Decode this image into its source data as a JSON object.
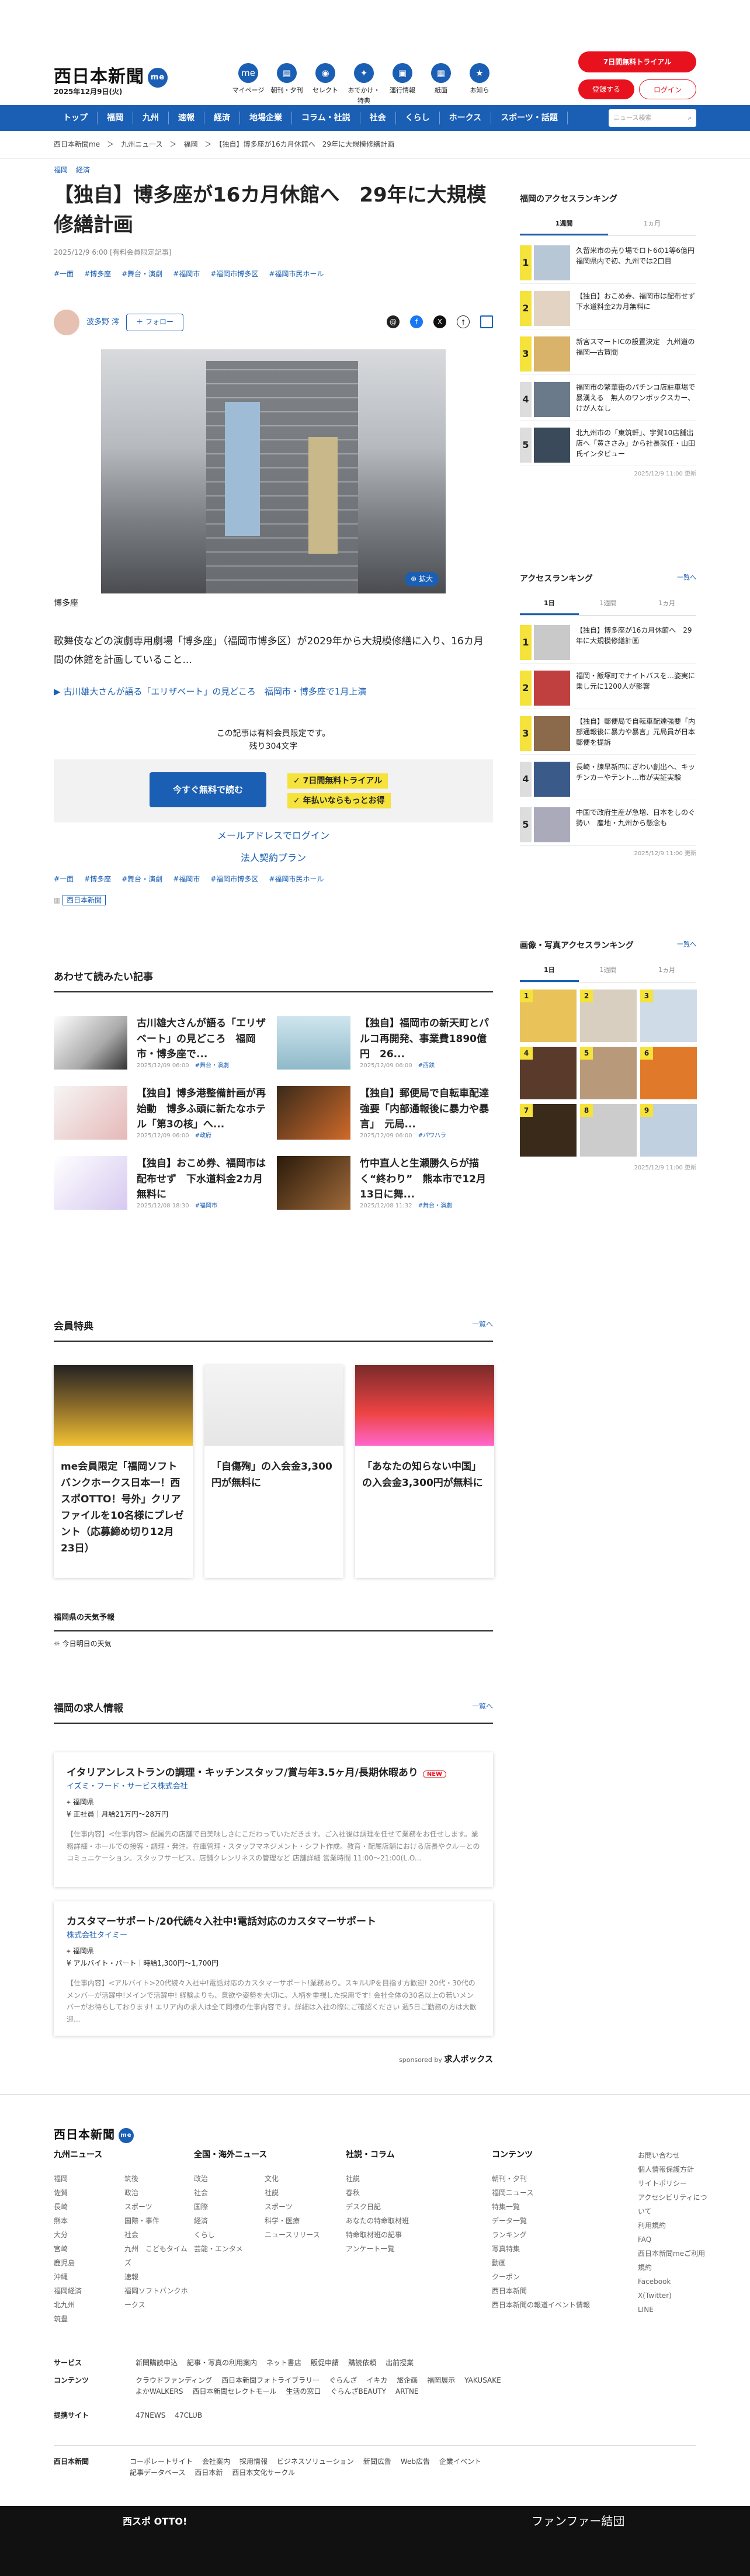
{
  "header": {
    "logo": "西日本新聞",
    "me": "me",
    "date": "2025年12月9日(火)",
    "nav": [
      {
        "label": "マイページ",
        "icon": "person-icon"
      },
      {
        "label": "朝刊・夕刊",
        "icon": "paper-icon"
      },
      {
        "label": "セレクト",
        "icon": "select-icon"
      },
      {
        "label": "おでかけ・特典",
        "icon": "ticket-icon"
      },
      {
        "label": "運行情報",
        "icon": "train-icon"
      },
      {
        "label": "紙面",
        "icon": "newspaper-icon"
      },
      {
        "label": "お知ら",
        "icon": "police-icon"
      }
    ],
    "trial": "7日間無料トライアル",
    "register": "登録する",
    "login": "ログイン"
  },
  "gnav": {
    "items": [
      "トップ",
      "福岡",
      "九州",
      "速報",
      "経済",
      "地場企業",
      "コラム・社説",
      "社会",
      "くらし",
      "ホークス",
      "スポーツ・話題"
    ],
    "search": "ニュース検索"
  },
  "breadcrumb": "西日本新聞me　＞　九州ニュース　＞　福岡　＞　【独自】博多座が16カ月休館へ　29年に大規模修繕計画",
  "article": {
    "categories": [
      "福岡",
      "経済"
    ],
    "title": "【独自】博多座が16カ月休館へ　29年に大規模修繕計画",
    "meta": "2025/12/9 6:00 [有料会員限定記事]",
    "tags": [
      "#一面",
      "#博多座",
      "#舞台・演劇",
      "#福岡市",
      "#福岡市博多区",
      "#福岡市民ホール"
    ],
    "author": "波多野 澪",
    "follow": "＋ フォロー",
    "zoom": "拡大",
    "caption": "博多座",
    "lede": "歌舞伎などの演劇専用劇場「博多座」（福岡市博多区）が2029年から大規模修繕に入り、16カ月間の休館を計画していること...",
    "related": "古川雄大さんが語る「エリザベート」の見どころ　福岡市・博多座で1月上演",
    "paywall_note": "この記事は有料会員限定です。",
    "remaining": "残り304文字",
    "cta": "今すぐ無料で読む",
    "check1": "7日間無料トライアル",
    "check2": "年払いならもっとお得",
    "mail_login": "メールアドレスでログイン",
    "corp": "法人契約プラン",
    "badge": "西日本新聞"
  },
  "recommend": {
    "title": "あわせて読みたい記事",
    "items": [
      {
        "title": "古川雄大さんが語る「エリザベート」の見どころ　福岡市・博多座で...",
        "date": "2025/12/09 06:00",
        "cat": "#舞台・演劇"
      },
      {
        "title": "【独自】福岡市の新天町とパルコ再開発、事業費1890億円　26...",
        "date": "2025/12/09 06:00",
        "cat": "#西鉄"
      },
      {
        "title": "【独自】博多港整備計画が再始動　博多ふ頭に新たなホテル「第3の核」へ...",
        "date": "2025/12/09 06:00",
        "cat": "#政府"
      },
      {
        "title": "【独自】郵便局で自転車配達強要「内部通報後に暴力や暴言」　元局...",
        "date": "2025/12/09 06:00",
        "cat": "#パワハラ"
      },
      {
        "title": "【独自】おこめ券、福岡市は配布せず　下水道料金2カ月無料に",
        "date": "2025/12/08 18:30",
        "cat": "#福岡市"
      },
      {
        "title": "竹中直人と生瀬勝久らが描く“終わり”　熊本市で12月13日に舞...",
        "date": "2025/12/08 11:32",
        "cat": "#舞台・演劇"
      }
    ]
  },
  "perks": {
    "title": "会員特典",
    "more": "一覧へ",
    "items": [
      "me会員限定「福岡ソフトバンクホークス日本一！西スポOTTO！号外」クリアファイルを10名様にプレゼント（応募締め切り12月23日）",
      "「自傷殉」の入会金3,300円が無料に",
      "「あなたの知らない中国」の入会金3,300円が無料に"
    ]
  },
  "weather": {
    "title": "福岡県の天気予報",
    "today": "今日明日の天気"
  },
  "jobs": {
    "title": "福岡の求人情報",
    "more": "一覧へ",
    "items": [
      {
        "title": "イタリアンレストランの調理・キッチンスタッフ/賞与年3.5ヶ月/長期休暇あり",
        "new": "NEW",
        "company": "イズミ・フード・サービス株式会社",
        "place": "福岡県",
        "pay": "正社員｜月給21万円〜28万円",
        "desc": "【仕事内容】<仕事内容> 配属先の店舗で自美味しさにこだわっていただきます。ご入社後は調理を任せて業務をお任せします。業務詳細・ホールでの接客・調理・発注。在庫管理・スタッフマネジメント・シフト作成。教育・配属店舗における店長やクルーとのコミュニケーション。スタッフサービス、店舗クレンリネスの管理など 店舗詳細 営業時間 11:00〜21:00(L.O..."
      },
      {
        "title": "カスタマーサポート/20代続々入社中!電話対応のカスタマーサポート",
        "new": "",
        "company": "株式会社タイミー",
        "place": "福岡県",
        "pay": "アルバイト・パート｜時給1,300円〜1,700円",
        "desc": "【仕事内容】<アルバイト>20代続々入社中!電話対応のカスタマーサポート!業務あり。スキルUPを目指す方歓迎! 20代・30代のメンバーが活躍中!メインで活躍中! 経験よりも、意欲や姿勢を大切に。人柄を重視した採用です! 会社全体の30名以上の若いメンバーがお待ちしております! エリア内の求人は全て同様の仕事内容です。詳細は入社の際にご確認ください 週5日ご勤務の方は大歓迎..."
      }
    ],
    "sponsor": "sponsored by",
    "sponsor_brand": "求人ボックス"
  },
  "sidebar": {
    "ranking_title": "福岡のアクセスランキング",
    "tabs1": [
      "1週間",
      "1ヵ月"
    ],
    "ranking1": [
      "久留米市の売り場でロト6の1等6億円　福岡県内で初、九州では2口目",
      "【独自】おこめ券、福岡市は配布せず　下水道料金2カ月無料に",
      "新宮スマートICの設置決定　九州道の福岡―古賀間",
      "福岡市の繁華街のパチンコ店駐車場で暴漢える　無人のワンボックスカー、けが人なし",
      "北九州市の「東筑軒」、宇賀10店舗出店へ「黄ささみ」から社長就任・山田氏インタビュー"
    ],
    "upd1": "2025/12/9 11:00 更新",
    "access_title": "アクセスランキング",
    "access_more": "一覧へ",
    "tabs2": [
      "1日",
      "1週間",
      "1ヵ月"
    ],
    "ranking2": [
      "【独自】博多座が16カ月休館へ　29年に大規模修繕計画",
      "福岡・飯塚町でナイトバスを…姿実に乗し元に1200人が影響",
      "【独自】郵便局で自転車配達強要「内部通報後に暴力や暴言」元局員が日本郵便を提訴",
      "長崎・諫早新四にぎわい創出へ、キッチンカーやテント…市が実証実験",
      "中国で政府生産が急増、日本をしのぐ勢い　産地・九州から懸念も"
    ],
    "upd2": "2025/12/9 11:00 更新",
    "photo_title": "画像・写真アクセスランキング",
    "photo_more": "一覧へ",
    "tabs3": [
      "1日",
      "1週間",
      "1ヵ月"
    ],
    "upd3": "2025/12/9 11:00 更新"
  },
  "footer": {
    "logo": "西日本新聞",
    "me": "me",
    "cols": [
      {
        "h": "九州ニュース",
        "items": [
          "福岡",
          "佐賀",
          "長崎",
          "熊本",
          "大分",
          "宮崎",
          "鹿児島",
          "沖縄",
          "福岡経済",
          "北九州",
          "筑豊",
          "筑後",
          "政治",
          "スポーツ",
          "国際・事件",
          "社会",
          "九州　こどもタイムズ",
          "速報",
          "福岡ソフトバンクホークス"
        ]
      },
      {
        "h": "全国・海外ニュース",
        "items": [
          "政治",
          "社会",
          "国際",
          "経済",
          "くらし",
          "芸能・エンタメ",
          "文化",
          "社説",
          "スポーツ",
          "科学・医療",
          "ニュースリリース"
        ]
      },
      {
        "h": "社説・コラム",
        "items": [
          "社説",
          "春秋",
          "デスク日記",
          "あなたの特命取材班",
          "特命取材班の記事",
          "アンケート一覧"
        ]
      },
      {
        "h": "コンテンツ",
        "items": [
          "朝刊・夕刊",
          "福岡ニュース",
          "特集一覧",
          "データ一覧",
          "ランキング",
          "写真特集",
          "動画",
          "クーポン",
          "西日本新聞",
          "西日本新聞の報道イベント情報"
        ]
      },
      {
        "h": "",
        "items": [
          "お問い合わせ",
          "個人情報保護方針",
          "サイトポリシー",
          "アクセシビリティについて",
          "利用規約",
          "FAQ",
          "西日本新聞meご利用規約",
          "Facebook",
          "X(Twitter)",
          "LINE"
        ]
      }
    ],
    "services": {
      "h": "サービス",
      "items": [
        "新聞購読申込",
        "記事・写真の利用案内",
        "ネット書店",
        "販促申請",
        "購読依頼",
        "出前授業"
      ]
    },
    "contents": {
      "h": "コンテンツ",
      "items": [
        "クラウドファンディング",
        "西日本新聞フォトライブラリー",
        "ぐらんざ",
        "イキカ",
        "旅企画",
        "福岡展示",
        "YAKUSAKE",
        "よかWALKERS",
        "西日本新聞セレクトモール",
        "生活の窓口",
        "ぐらんざBEAUTY",
        "ARTNE"
      ]
    },
    "affil": {
      "h": "提携サイト",
      "items": [
        "47NEWS",
        "47CLUB"
      ]
    },
    "bottom": {
      "logo": "西日本新聞",
      "items": [
        "コーポレートサイト",
        "会社案内",
        "採用情報",
        "ビジネスソリューション",
        "新聞広告",
        "Web広告",
        "企業イベント",
        "記事データベース",
        "西日本新",
        "西日本文化サークル"
      ]
    },
    "banner": "西スポ OTTO!",
    "banner2": "ファンファー結団"
  }
}
